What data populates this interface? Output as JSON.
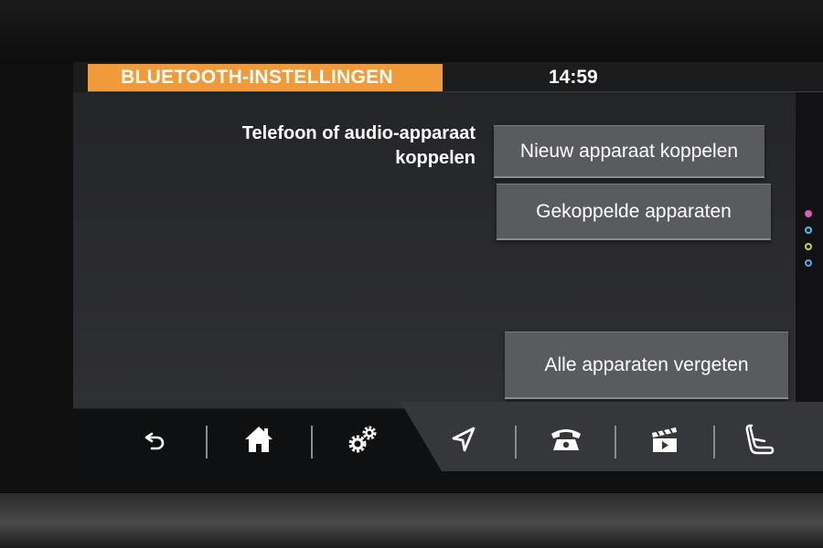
{
  "header": {
    "title": "BLUETOOTH-INSTELLINGEN",
    "time": "14:59"
  },
  "content": {
    "description_line1": "Telefoon of audio-apparaat",
    "description_line2": "koppelen",
    "buttons": {
      "pair_new": "Nieuw apparaat koppelen",
      "paired_devices": "Gekoppelde apparaten",
      "forget_all": "Alle apparaten vergeten"
    }
  },
  "dock": {
    "items": [
      "back-icon",
      "home-icon",
      "settings-icon",
      "navigation-icon",
      "phone-icon",
      "media-icon",
      "seat-icon"
    ]
  },
  "colors": {
    "accent": "#f09a3a",
    "button": "#5a5b5e",
    "background": "#2a2b2e"
  }
}
